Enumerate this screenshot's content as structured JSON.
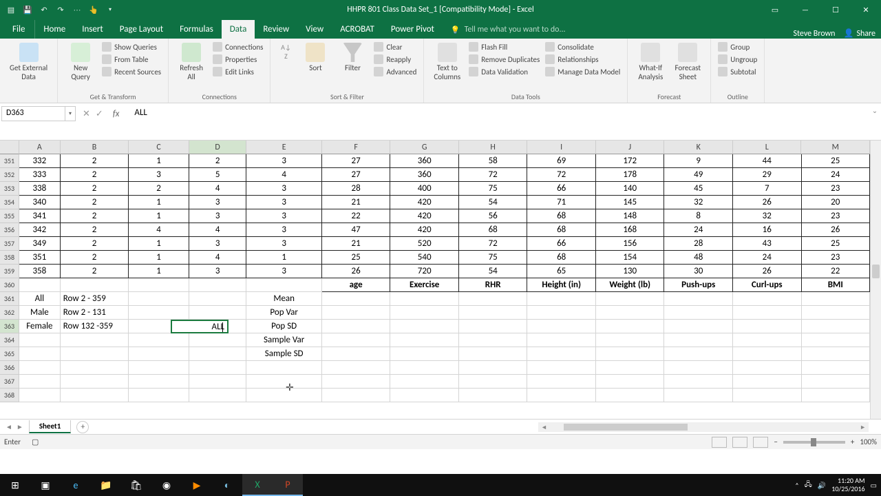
{
  "title": "HHPR 801 Class Data Set_1  [Compatibility Mode] - Excel",
  "user": "Steve Brown",
  "share": "Share",
  "tabs": [
    "Home",
    "Insert",
    "Page Layout",
    "Formulas",
    "Data",
    "Review",
    "View",
    "ACROBAT",
    "Power Pivot"
  ],
  "active_tab": "Data",
  "file_tab": "File",
  "tellme": "Tell me what you want to do...",
  "namebox": "D363",
  "formula": "ALL",
  "status": "Enter",
  "zoom": "100%",
  "sheet": "Sheet1",
  "clock": {
    "time": "11:20 AM",
    "date": "10/25/2016"
  },
  "ribbon": {
    "get_external": "Get External\nData",
    "new_query": "New\nQuery",
    "show_queries": "Show Queries",
    "from_table": "From Table",
    "recent_sources": "Recent Sources",
    "refresh_all": "Refresh\nAll",
    "connections": "Connections",
    "properties": "Properties",
    "edit_links": "Edit Links",
    "sort": "Sort",
    "filter": "Filter",
    "clear": "Clear",
    "reapply": "Reapply",
    "advanced": "Advanced",
    "text_to_cols": "Text to\nColumns",
    "flash_fill": "Flash Fill",
    "remove_dup": "Remove Duplicates",
    "data_val": "Data Validation",
    "consolidate": "Consolidate",
    "relationships": "Relationships",
    "manage_dm": "Manage Data Model",
    "whatif": "What-If\nAnalysis",
    "forecast_sheet": "Forecast\nSheet",
    "group_btn": "Group",
    "ungroup": "Ungroup",
    "subtotal": "Subtotal",
    "g_get": "Get & Transform",
    "g_conn": "Connections",
    "g_sort": "Sort & Filter",
    "g_tools": "Data Tools",
    "g_forecast": "Forecast",
    "g_outline": "Outline"
  },
  "columns": [
    "A",
    "B",
    "C",
    "D",
    "E",
    "F",
    "G",
    "H",
    "I",
    "J",
    "K",
    "L",
    "M"
  ],
  "row_nums": [
    "351",
    "352",
    "353",
    "354",
    "355",
    "356",
    "357",
    "358",
    "359",
    "360",
    "361",
    "362",
    "363",
    "364",
    "365",
    "366",
    "367",
    "368"
  ],
  "data_rows": [
    [
      "332",
      "2",
      "1",
      "2",
      "3",
      "27",
      "360",
      "58",
      "69",
      "172",
      "9",
      "44",
      "25"
    ],
    [
      "333",
      "2",
      "3",
      "5",
      "4",
      "27",
      "360",
      "72",
      "72",
      "178",
      "49",
      "29",
      "24"
    ],
    [
      "338",
      "2",
      "2",
      "4",
      "3",
      "28",
      "400",
      "75",
      "66",
      "140",
      "45",
      "7",
      "23"
    ],
    [
      "340",
      "2",
      "1",
      "3",
      "3",
      "21",
      "420",
      "54",
      "71",
      "145",
      "32",
      "26",
      "20"
    ],
    [
      "341",
      "2",
      "1",
      "3",
      "3",
      "22",
      "420",
      "56",
      "68",
      "148",
      "8",
      "32",
      "23"
    ],
    [
      "342",
      "2",
      "4",
      "4",
      "3",
      "47",
      "420",
      "68",
      "68",
      "168",
      "24",
      "16",
      "26"
    ],
    [
      "349",
      "2",
      "1",
      "3",
      "3",
      "21",
      "520",
      "72",
      "66",
      "156",
      "28",
      "43",
      "25"
    ],
    [
      "351",
      "2",
      "1",
      "4",
      "1",
      "25",
      "540",
      "75",
      "68",
      "154",
      "48",
      "24",
      "23"
    ],
    [
      "358",
      "2",
      "1",
      "3",
      "3",
      "26",
      "720",
      "54",
      "65",
      "130",
      "30",
      "26",
      "22"
    ]
  ],
  "header_row": [
    "",
    "",
    "",
    "",
    "",
    "age",
    "Exercise",
    "RHR",
    "Height (in)",
    "Weight (lb)",
    "Push-ups",
    "Curl-ups",
    "BMI"
  ],
  "label_rows": [
    [
      "All",
      "Row 2 - 359",
      "",
      "",
      "Mean",
      "",
      "",
      "",
      "",
      "",
      "",
      "",
      ""
    ],
    [
      "Male",
      "Row 2 - 131",
      "",
      "",
      "Pop Var",
      "",
      "",
      "",
      "",
      "",
      "",
      "",
      ""
    ],
    [
      "Female",
      "Row 132 -359",
      "",
      "ALL",
      "Pop SD",
      "",
      "",
      "",
      "",
      "",
      "",
      "",
      ""
    ],
    [
      "",
      "",
      "",
      "",
      "Sample Var",
      "",
      "",
      "",
      "",
      "",
      "",
      "",
      ""
    ],
    [
      "",
      "",
      "",
      "",
      "Sample SD",
      "",
      "",
      "",
      "",
      "",
      "",
      "",
      ""
    ],
    [
      "",
      "",
      "",
      "",
      "",
      "",
      "",
      "",
      "",
      "",
      "",
      "",
      ""
    ],
    [
      "",
      "",
      "",
      "",
      "",
      "",
      "",
      "",
      "",
      "",
      "",
      "",
      ""
    ],
    [
      "",
      "",
      "",
      "",
      "",
      "",
      "",
      "",
      "",
      "",
      "",
      "",
      ""
    ]
  ],
  "sel_value": "ALL"
}
